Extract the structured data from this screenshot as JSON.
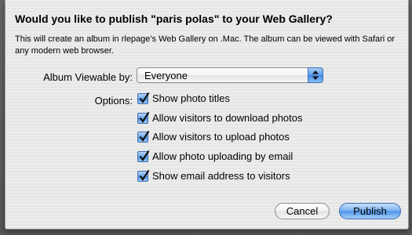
{
  "dialog": {
    "title": "Would you like to publish \"paris polas\" to your Web Gallery?",
    "description": "This will create an album in rlepage's Web Gallery on .Mac. The album can be viewed with Safari or any modern web browser."
  },
  "album_viewable": {
    "label": "Album Viewable by:",
    "selected": "Everyone"
  },
  "options": {
    "label": "Options:",
    "items": [
      {
        "label": "Show photo titles",
        "checked": true
      },
      {
        "label": "Allow visitors to download photos",
        "checked": true
      },
      {
        "label": "Allow visitors to upload photos",
        "checked": true
      },
      {
        "label": "Allow photo uploading by email",
        "checked": true
      },
      {
        "label": "Show email address to visitors",
        "checked": true
      }
    ]
  },
  "buttons": {
    "cancel": "Cancel",
    "publish": "Publish"
  },
  "colors": {
    "accent": "#4b94e8",
    "sheet_background": "#ececec"
  }
}
